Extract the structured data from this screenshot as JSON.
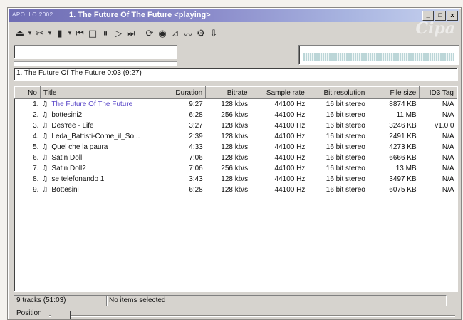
{
  "window": {
    "app_name": "APOLLO 2002",
    "title": "1. The Future Of The Future <playing>",
    "controls": {
      "minimize": "_",
      "maximize": "□",
      "close": "x"
    },
    "watermark": "Cipa"
  },
  "toolbar": {
    "icons": [
      {
        "name": "eject-icon",
        "glyph": "⏏"
      },
      {
        "name": "dropdown-icon",
        "glyph": "▾"
      },
      {
        "name": "tools-icon",
        "glyph": "✂"
      },
      {
        "name": "dropdown-icon",
        "glyph": "▾"
      },
      {
        "name": "playlist-icon",
        "glyph": "▮"
      },
      {
        "name": "dropdown-icon",
        "glyph": "▾"
      },
      {
        "name": "previous-track-icon",
        "glyph": "⏮"
      },
      {
        "name": "stop-icon",
        "glyph": "□"
      },
      {
        "name": "pause-icon",
        "glyph": "⏸"
      },
      {
        "name": "play-icon",
        "glyph": "▷"
      },
      {
        "name": "next-track-icon",
        "glyph": "⏭"
      },
      {
        "name": "repeat-icon",
        "glyph": "⟳"
      },
      {
        "name": "shuffle-icon",
        "glyph": "◉"
      },
      {
        "name": "equalizer-icon",
        "glyph": "⊿"
      },
      {
        "name": "visualization-icon",
        "glyph": "〰"
      },
      {
        "name": "settings-icon",
        "glyph": "⚙"
      },
      {
        "name": "download-icon",
        "glyph": "⇩"
      }
    ]
  },
  "now_playing": {
    "text": "1. The Future Of The Future 0:03 (9:27)",
    "position_fraction": 0.005
  },
  "playlist": {
    "columns": [
      "No",
      "Title",
      "Duration",
      "Bitrate",
      "Sample rate",
      "Bit resolution",
      "File size",
      "ID3 Tag"
    ],
    "rows": [
      {
        "no": "1.",
        "title": "The Future Of The Future",
        "duration": "9:27",
        "bitrate": "128 kb/s",
        "sample_rate": "44100 Hz",
        "bit_resolution": "16 bit stereo",
        "file_size": "8874 KB",
        "id3": "N/A",
        "playing": true
      },
      {
        "no": "2.",
        "title": "bottesini2",
        "duration": "6:28",
        "bitrate": "256 kb/s",
        "sample_rate": "44100 Hz",
        "bit_resolution": "16 bit stereo",
        "file_size": "11 MB",
        "id3": "N/A"
      },
      {
        "no": "3.",
        "title": "Des'ree - Life",
        "duration": "3:27",
        "bitrate": "128 kb/s",
        "sample_rate": "44100 Hz",
        "bit_resolution": "16 bit stereo",
        "file_size": "3246 KB",
        "id3": "v1.0.0"
      },
      {
        "no": "4.",
        "title": "Leda_Battisti-Come_il_So...",
        "duration": "2:39",
        "bitrate": "128 kb/s",
        "sample_rate": "44100 Hz",
        "bit_resolution": "16 bit stereo",
        "file_size": "2491 KB",
        "id3": "N/A"
      },
      {
        "no": "5.",
        "title": "Quel che la paura",
        "duration": "4:33",
        "bitrate": "128 kb/s",
        "sample_rate": "44100 Hz",
        "bit_resolution": "16 bit stereo",
        "file_size": "4273 KB",
        "id3": "N/A"
      },
      {
        "no": "6.",
        "title": "Satin Doll",
        "duration": "7:06",
        "bitrate": "128 kb/s",
        "sample_rate": "44100 Hz",
        "bit_resolution": "16 bit stereo",
        "file_size": "6666 KB",
        "id3": "N/A"
      },
      {
        "no": "7.",
        "title": "Satin Doll2",
        "duration": "7:06",
        "bitrate": "256 kb/s",
        "sample_rate": "44100 Hz",
        "bit_resolution": "16 bit stereo",
        "file_size": "13 MB",
        "id3": "N/A"
      },
      {
        "no": "8.",
        "title": "se telefonando 1",
        "duration": "3:43",
        "bitrate": "128 kb/s",
        "sample_rate": "44100 Hz",
        "bit_resolution": "16 bit stereo",
        "file_size": "3497 KB",
        "id3": "N/A"
      },
      {
        "no": "9.",
        "title": "Bottesini",
        "duration": "6:28",
        "bitrate": "128 kb/s",
        "sample_rate": "44100 Hz",
        "bit_resolution": "16 bit stereo",
        "file_size": "6075 KB",
        "id3": "N/A"
      }
    ]
  },
  "status": {
    "tracks": "9 tracks (51:03)",
    "selection": "No items selected"
  },
  "position_bar": {
    "label": "Position",
    "value_fraction": 0.0
  },
  "colors": {
    "playing_track": "#5a48c8",
    "titlebar_start": "#6f6db4",
    "titlebar_end": "#c8d3ef"
  }
}
